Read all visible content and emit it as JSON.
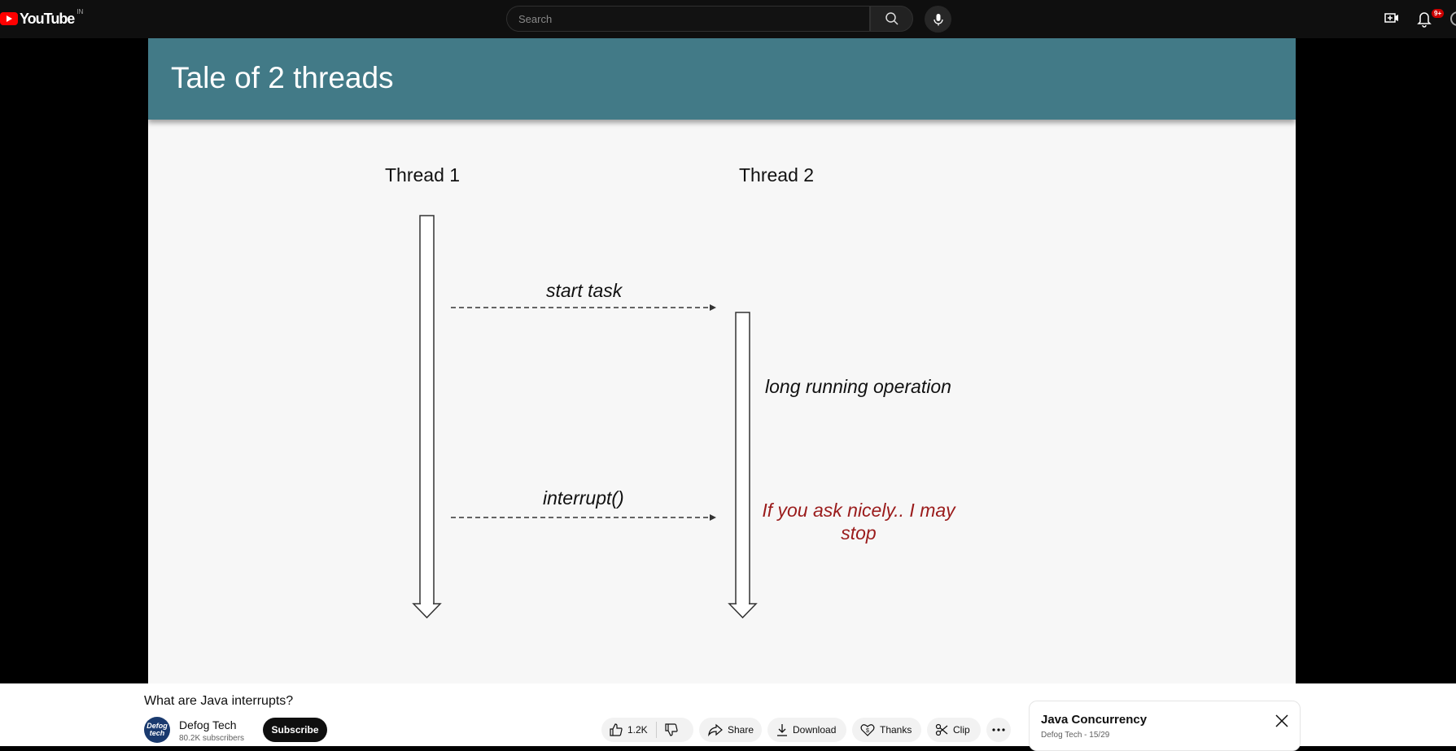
{
  "header": {
    "logo_text": "YouTube",
    "country_code": "IN",
    "search_placeholder": "Search",
    "notification_count": "9+"
  },
  "slide": {
    "title": "Tale of 2 threads",
    "thread1_label": "Thread 1",
    "thread2_label": "Thread 2",
    "msg_start": "start task",
    "msg_long": "long running operation",
    "msg_interrupt": "interrupt()",
    "msg_stop": "If you ask nicely.. I may stop"
  },
  "video": {
    "title": "What are Java interrupts?",
    "channel_name": "Defog Tech",
    "channel_avatar_text": "Defog tech",
    "subscribers": "80.2K subscribers",
    "subscribe_label": "Subscribe",
    "like_count": "1.2K",
    "share_label": "Share",
    "download_label": "Download",
    "thanks_label": "Thanks",
    "clip_label": "Clip"
  },
  "playlist": {
    "title": "Java Concurrency",
    "subtitle": "Defog Tech - 15/29"
  },
  "colors": {
    "slide_header": "#427a87",
    "red_text": "#9a1b1b",
    "brand_red": "#ff0000"
  }
}
